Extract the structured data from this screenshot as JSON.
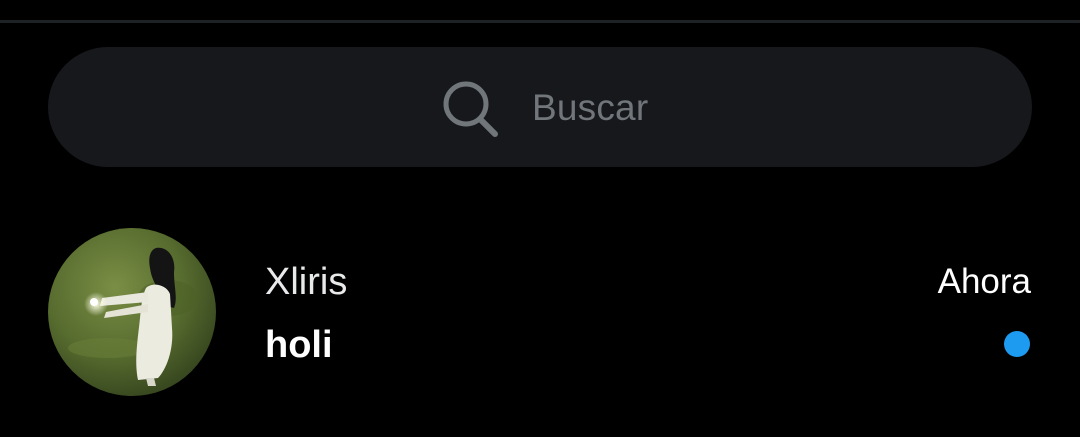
{
  "search": {
    "icon": "search-icon",
    "placeholder": "Buscar"
  },
  "conversation": {
    "name": "Xliris",
    "message": "holi",
    "time": "Ahora",
    "unread": true,
    "avatar": "avatar-photo"
  },
  "colors": {
    "background": "#000000",
    "search_bg": "#16181c",
    "placeholder_text": "#71767b",
    "unread_dot": "#1d9bf0"
  }
}
